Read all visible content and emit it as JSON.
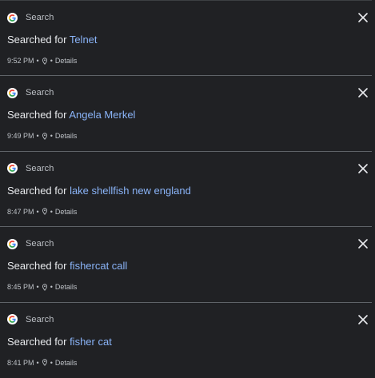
{
  "activity": {
    "items": [
      {
        "product": "Search",
        "title_prefix": "Searched for",
        "query": "Telnet",
        "time": "9:52 PM",
        "details_label": "Details"
      },
      {
        "product": "Search",
        "title_prefix": "Searched for",
        "query": "Angela Merkel",
        "time": "9:49 PM",
        "details_label": "Details"
      },
      {
        "product": "Search",
        "title_prefix": "Searched for",
        "query": "lake shellfish new england",
        "time": "8:47 PM",
        "details_label": "Details"
      },
      {
        "product": "Search",
        "title_prefix": "Searched for",
        "query": "fishercat call",
        "time": "8:45 PM",
        "details_label": "Details"
      },
      {
        "product": "Search",
        "title_prefix": "Searched for",
        "query": "fisher cat",
        "time": "8:41 PM",
        "details_label": "Details"
      }
    ],
    "separator": "•",
    "icons": {
      "product": "google-g-icon",
      "close": "close-icon",
      "location": "location-pin-icon"
    }
  },
  "colors": {
    "background": "#202124",
    "text": "#e8eaed",
    "secondary_text": "#bdc1c6",
    "link": "#8ab4f8",
    "divider": "#5f6368"
  }
}
